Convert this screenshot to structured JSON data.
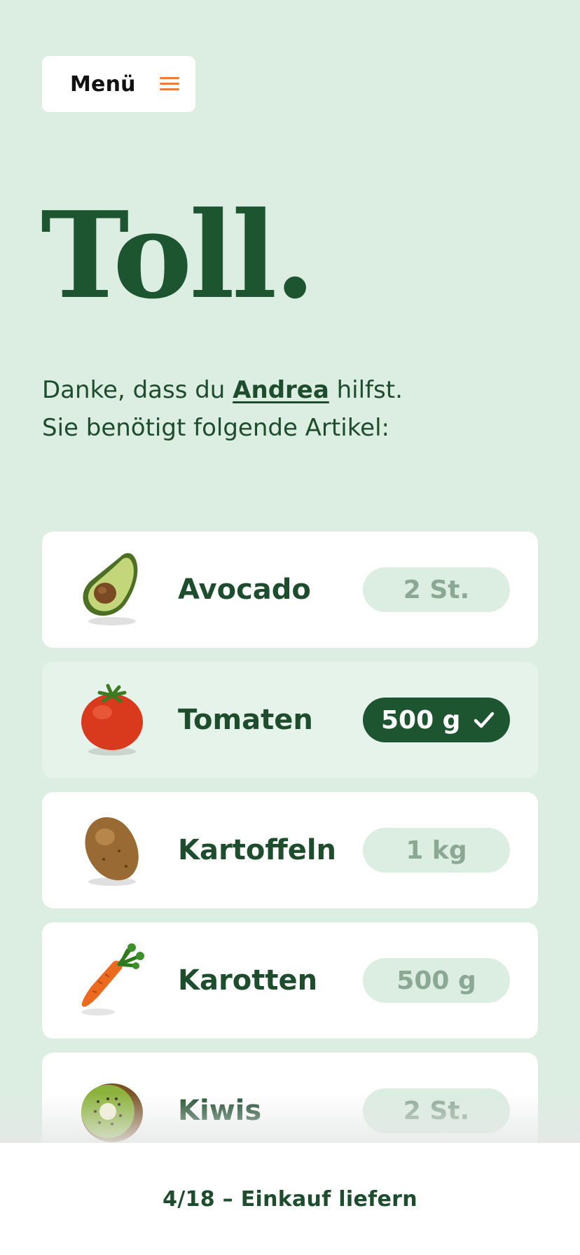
{
  "menu": {
    "label": "Menü",
    "icon": "hamburger-icon",
    "accent": "#f07a3c"
  },
  "headline": "Toll.",
  "intro": {
    "line1_before": "Danke, dass du ",
    "name": "Andrea",
    "line1_after": " hilfst.",
    "line2": "Sie benötigt folgende Artikel:"
  },
  "items": [
    {
      "name": "Avocado",
      "quantity": "2 St.",
      "checked": false,
      "icon": "avocado-icon"
    },
    {
      "name": "Tomaten",
      "quantity": "500 g",
      "checked": true,
      "icon": "tomato-icon"
    },
    {
      "name": "Kartoffeln",
      "quantity": "1 kg",
      "checked": false,
      "icon": "potato-icon"
    },
    {
      "name": "Karotten",
      "quantity": "500 g",
      "checked": false,
      "icon": "carrot-icon"
    },
    {
      "name": "Kiwis",
      "quantity": "2 St.",
      "checked": false,
      "icon": "kiwi-icon"
    }
  ],
  "footer": {
    "label": "4/18 – Einkauf liefern"
  },
  "colors": {
    "background": "#dcede2",
    "primary": "#1c5530",
    "text": "#1e4d2e",
    "pill": "#dcede2",
    "pill_text": "#8ba894"
  }
}
